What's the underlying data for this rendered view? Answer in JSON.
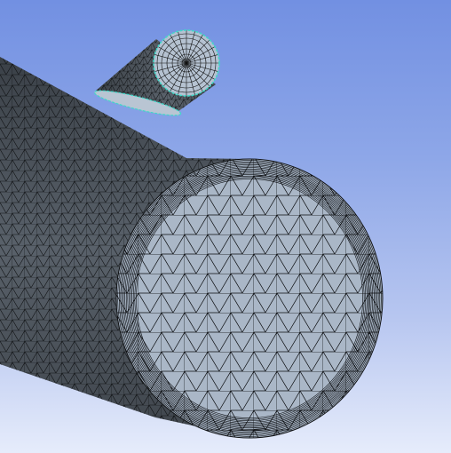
{
  "viewport": {
    "background_top": "#7290e2",
    "background_bottom": "#e6ecfb"
  },
  "scene": {
    "main_cylinder": {
      "face_color": "#aab7c7",
      "side_color": "#50565c",
      "mesh_color": "#0a0a0a"
    },
    "branch_cylinder": {
      "face_color": "#b5c2d1",
      "side_color": "#4a5056",
      "mesh_color": "#111111"
    },
    "highlight_edge_color": "#3fd8c8"
  }
}
